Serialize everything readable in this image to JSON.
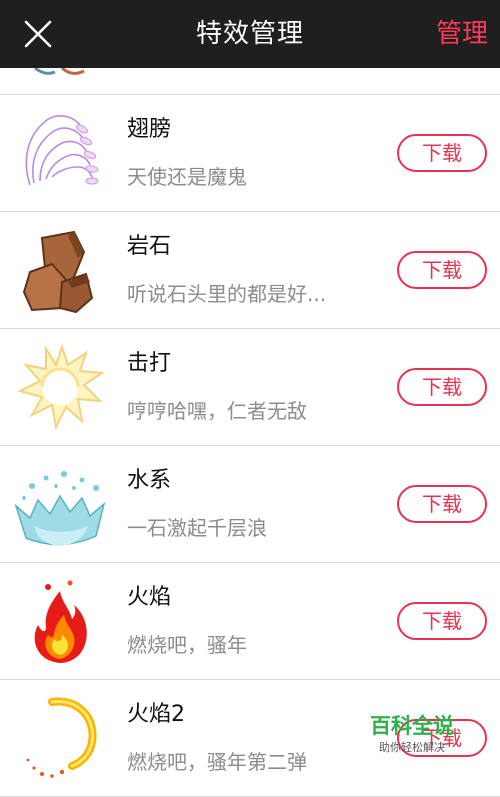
{
  "header": {
    "title": "特效管理",
    "right_action": "管理",
    "close_icon": "close-icon"
  },
  "colors": {
    "header_bg": "#1f1f1f",
    "accent": "#e8324f",
    "manage_text": "#ff3b5c",
    "desc_text": "#8c8c8c",
    "divider": "#dcdcdc",
    "watermark_green": "#2bb24c"
  },
  "effects": [
    {
      "name": "翅膀",
      "desc": "天使还是魔鬼",
      "action": "下载",
      "icon": "wings-icon"
    },
    {
      "name": "岩石",
      "desc": "听说石头里的都是好...",
      "action": "下载",
      "icon": "rock-icon"
    },
    {
      "name": "击打",
      "desc": "哼哼哈嘿，仁者无敌",
      "action": "下载",
      "icon": "hit-burst-icon"
    },
    {
      "name": "水系",
      "desc": "一石激起千层浪",
      "action": "下载",
      "icon": "water-splash-icon"
    },
    {
      "name": "火焰",
      "desc": "燃烧吧，骚年",
      "action": "下载",
      "icon": "flame-icon"
    },
    {
      "name": "火焰2",
      "desc": "燃烧吧，骚年第二弹",
      "action": "下载",
      "icon": "fire-ring-icon"
    }
  ],
  "watermark": {
    "title": "百科全说",
    "subtitle": "助你轻松解决"
  }
}
